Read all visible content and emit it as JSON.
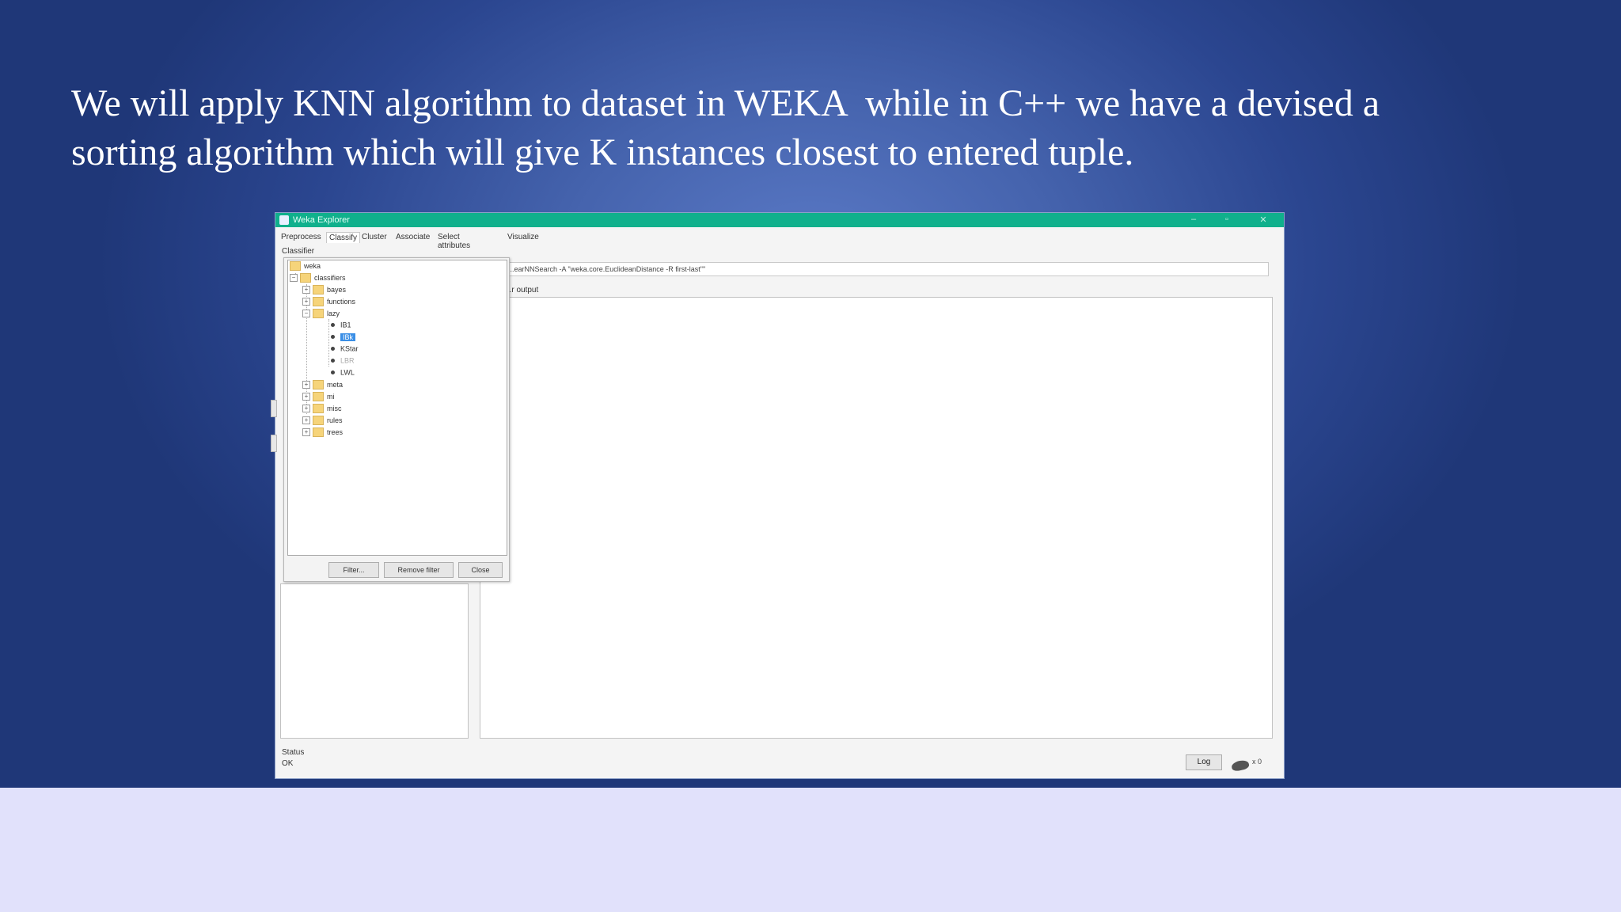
{
  "slide": {
    "text": "We will apply KNN algorithm to dataset in WEKA  while in C++ we have a devised a\nsorting algorithm which will give K instances closest to entered tuple."
  },
  "window": {
    "title": "Weka Explorer",
    "controls": {
      "minimize": "–",
      "maximize": "▫",
      "close": "✕"
    }
  },
  "tabs": [
    {
      "label": "Preprocess"
    },
    {
      "label": "Classify"
    },
    {
      "label": "Cluster"
    },
    {
      "label": "Associate"
    },
    {
      "label": "Select attributes"
    },
    {
      "label": "Visualize"
    }
  ],
  "classifier": {
    "section_label": "Classifier",
    "command": "...earNNSearch -A \"weka.core.EuclideanDistance -R first-last\"\""
  },
  "output": {
    "label": "...r output"
  },
  "tree": {
    "items": [
      {
        "label": "weka"
      },
      {
        "label": "classifiers"
      },
      {
        "label": "bayes"
      },
      {
        "label": "functions"
      },
      {
        "label": "lazy"
      },
      {
        "label": "IB1"
      },
      {
        "label": "IBk"
      },
      {
        "label": "KStar"
      },
      {
        "label": "LBR"
      },
      {
        "label": "LWL"
      },
      {
        "label": "meta"
      },
      {
        "label": "mi"
      },
      {
        "label": "misc"
      },
      {
        "label": "rules"
      },
      {
        "label": "trees"
      }
    ],
    "buttons": {
      "filter": "Filter...",
      "remove_filter": "Remove filter",
      "close": "Close"
    }
  },
  "status": {
    "section_label": "Status",
    "value": "OK",
    "log_button": "Log",
    "count": "x 0"
  },
  "colors": {
    "titlebar": "#10b08c",
    "selection": "#3b8fe6",
    "folder": "#f6d47a"
  }
}
